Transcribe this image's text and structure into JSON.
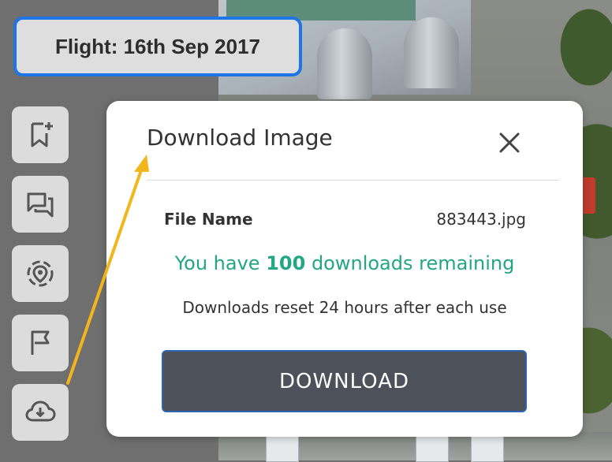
{
  "flight": {
    "label": "Flight: 16th Sep 2017"
  },
  "toolbar": {
    "buttons": [
      {
        "icon": "bookmark-add-icon"
      },
      {
        "icon": "comments-icon"
      },
      {
        "icon": "location-target-icon"
      },
      {
        "icon": "flag-icon"
      },
      {
        "icon": "cloud-download-icon"
      }
    ]
  },
  "dialog": {
    "title": "Download Image",
    "close_icon": "close-icon",
    "file_label": "File Name",
    "file_value": "883443.jpg",
    "remaining_prefix": "You have ",
    "remaining_count": "100",
    "remaining_suffix": " downloads remaining",
    "reset_note": "Downloads reset 24 hours after each use",
    "download_label": "DOWNLOAD"
  },
  "colors": {
    "accent_blue": "#1e76e6",
    "success_green": "#22a683",
    "button_dark": "#4d5159",
    "annotation_arrow": "#f2b51c"
  }
}
